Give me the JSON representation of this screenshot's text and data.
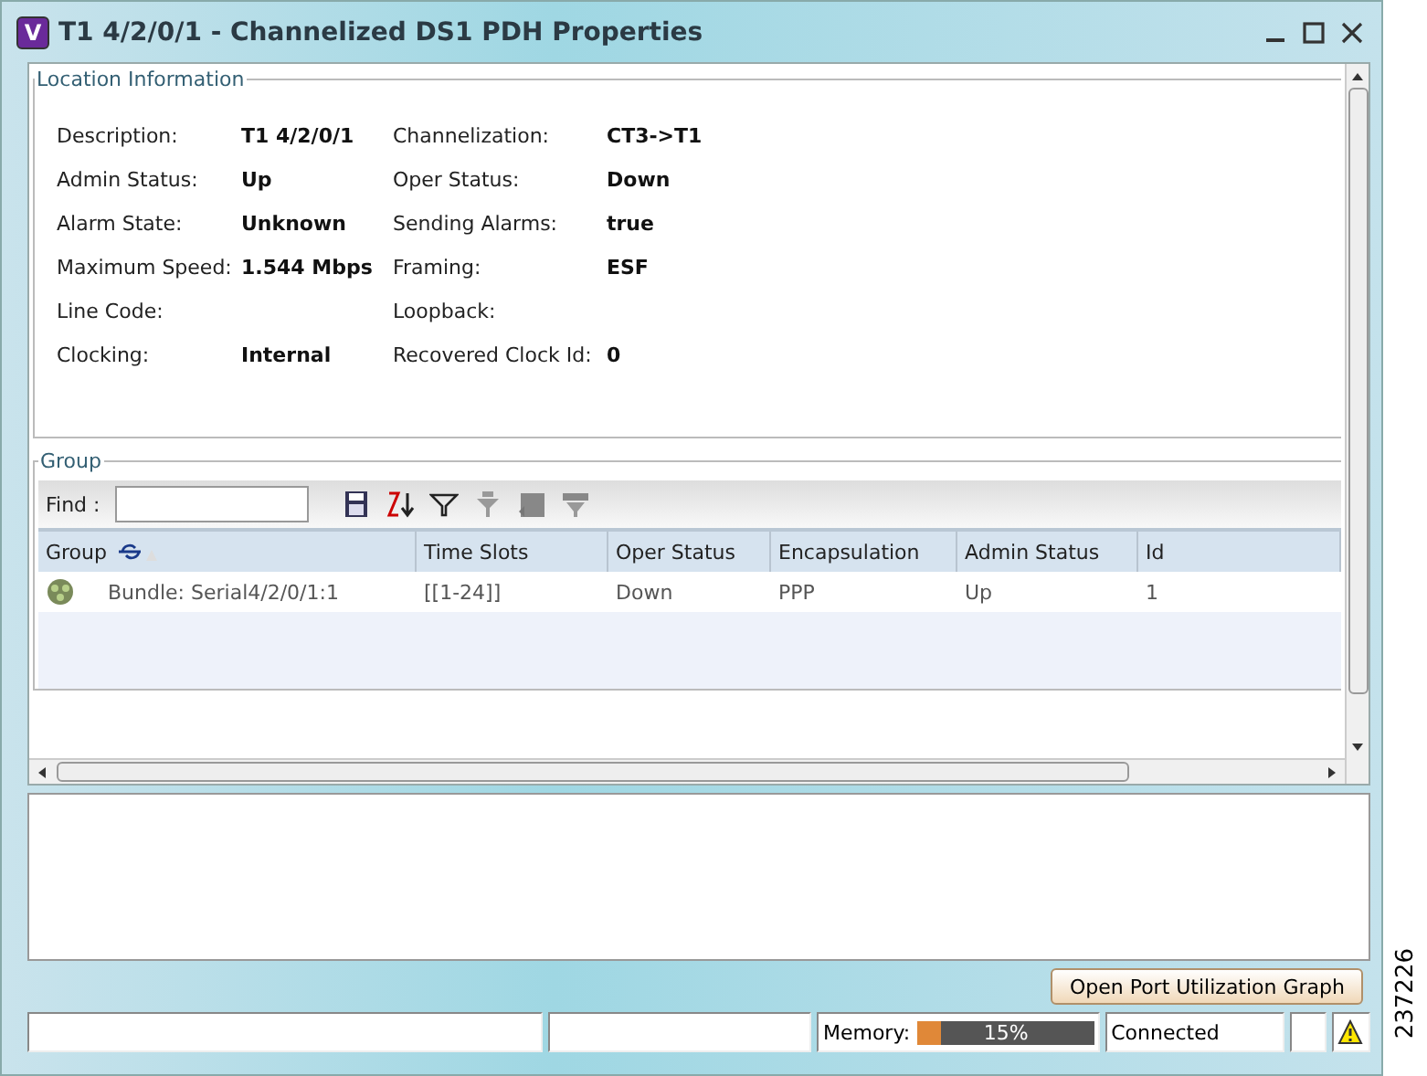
{
  "window": {
    "title": "T1 4/2/0/1 - Channelized DS1 PDH Properties",
    "app_icon_letter": "V"
  },
  "location_information": {
    "title": "Location Information",
    "rows": [
      [
        {
          "label": "Description:",
          "value": "T1 4/2/0/1"
        },
        {
          "label": "Channelization:",
          "value": "CT3->T1"
        }
      ],
      [
        {
          "label": "Admin Status:",
          "value": "Up"
        },
        {
          "label": "Oper Status:",
          "value": "Down"
        }
      ],
      [
        {
          "label": "Alarm State:",
          "value": "Unknown"
        },
        {
          "label": "Sending Alarms:",
          "value": "true"
        }
      ],
      [
        {
          "label": "Maximum Speed:",
          "value": "1.544 Mbps"
        },
        {
          "label": "Framing:",
          "value": "ESF"
        }
      ],
      [
        {
          "label": "Line Code:"
        },
        {
          "label": "Loopback:"
        }
      ],
      [
        {
          "label": "Clocking:",
          "value": "Internal"
        },
        {
          "label": "Recovered Clock Id:",
          "value": "0"
        }
      ]
    ]
  },
  "group": {
    "title": "Group",
    "find_label": "Find :",
    "table": {
      "columns": [
        "Group",
        "Time Slots",
        "Oper Status",
        "Encapsulation",
        "Admin Status",
        "Id"
      ],
      "rows": [
        {
          "cells": [
            "Bundle: Serial4/2/0/1:1",
            "[[1-24]]",
            "Down",
            "PPP",
            "Up",
            "1"
          ]
        }
      ]
    }
  },
  "buttons": [
    "Open Port Utilization Graph"
  ],
  "status_bar": {
    "memory_label": "Memory:",
    "memory": {
      "level": 0.13,
      "reading": "15%"
    },
    "connection": "Connected"
  },
  "figure_id": "237226"
}
